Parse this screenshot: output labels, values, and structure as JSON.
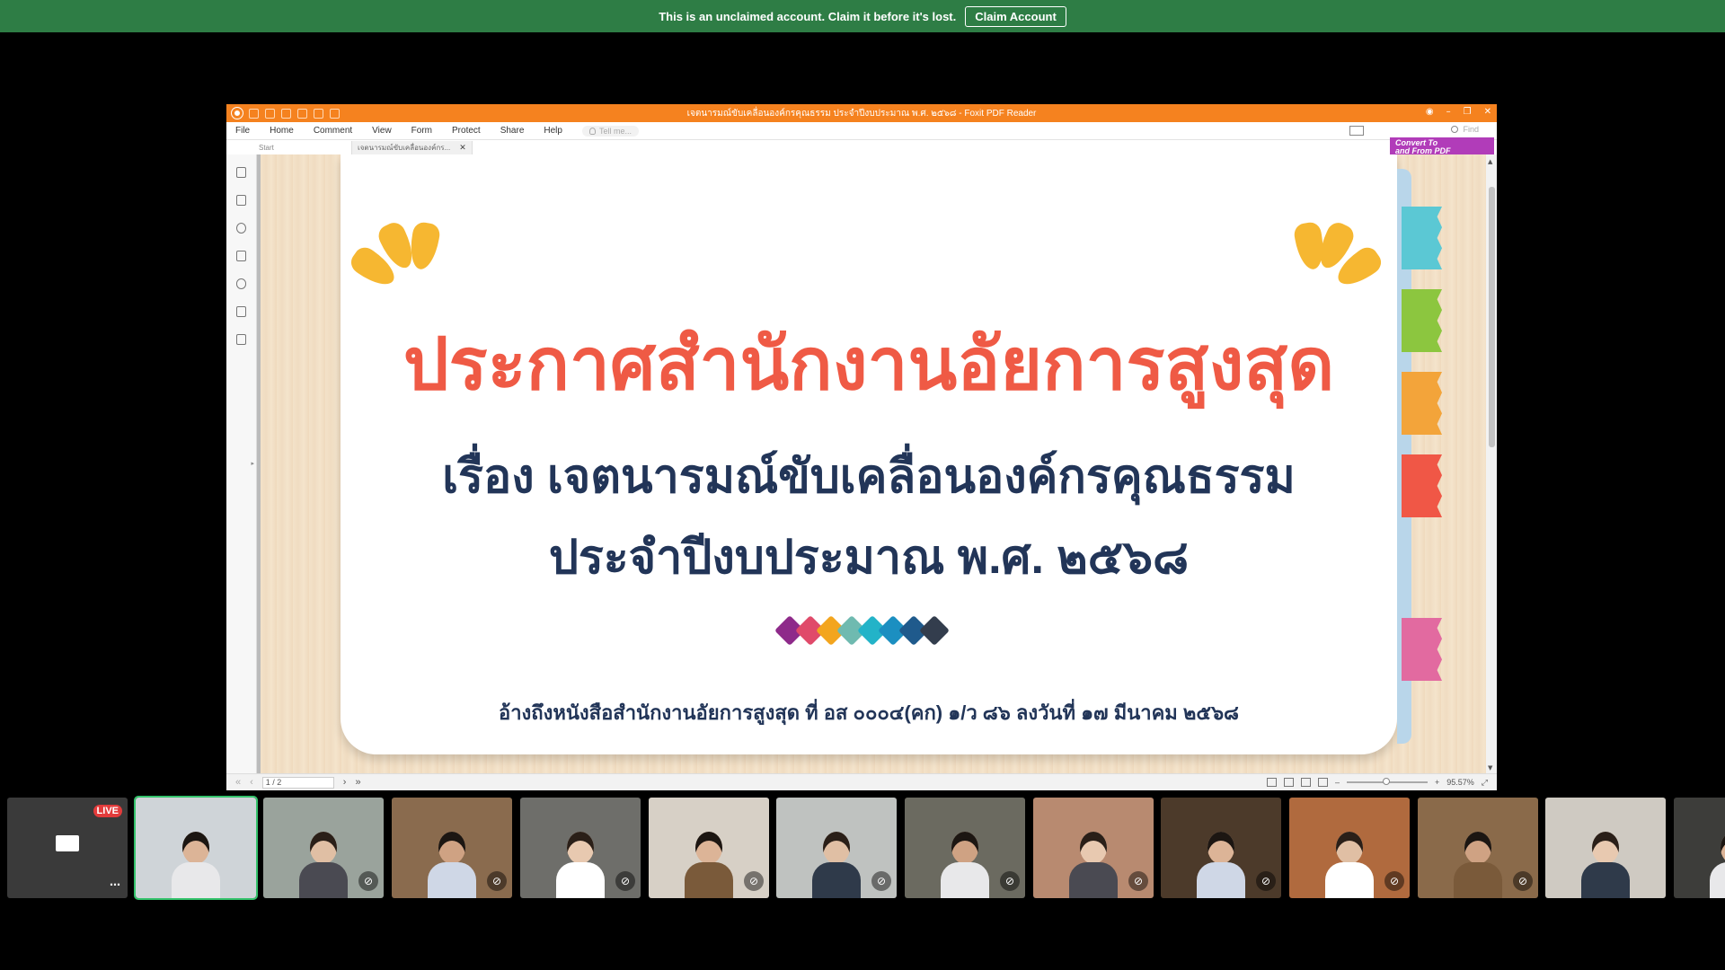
{
  "banner": {
    "message": "This is an unclaimed account. Claim it before it's lost.",
    "button_label": "Claim Account"
  },
  "pdf_reader": {
    "window_title": "เจตนารมณ์ขับเคลื่อนองค์กรคุณธรรม ประจำปีงบประมาณ พ.ศ. ๒๕๖๘ - Foxit PDF Reader",
    "menu": [
      "File",
      "Home",
      "Comment",
      "View",
      "Form",
      "Protect",
      "Share",
      "Help"
    ],
    "tell_me_placeholder": "Tell me...",
    "find_placeholder": "Find",
    "tabs": [
      {
        "label": "Start"
      },
      {
        "label": "เจตนารมณ์ขับเคลื่อนองค์กร..."
      }
    ],
    "convert_button": {
      "line1": "Convert To",
      "line2": "and From PDF"
    },
    "page_indicator": "1 / 2",
    "zoom_level": "95.57%"
  },
  "slide": {
    "title": "ประกาศสำนักงานอัยการสูงสุด",
    "subtitle_line1": "เรื่อง เจตนารมณ์ขับเคลื่อนองค์กรคุณธรรม",
    "subtitle_line2": "ประจำปีงบประมาณ พ.ศ. ๒๕๖๘",
    "reference": "อ้างถึงหนังสือสำนักงานอัยการสูงสุด ที่ อส ๐๐๐๔(คก) ๑/ว ๘๖ ลงวันที่ ๑๗ มีนาคม ๒๕๖๘",
    "diamond_colors": [
      "#8e2a8a",
      "#e04a6a",
      "#f3a51e",
      "#6fbab0",
      "#23b3c8",
      "#1b8fc1",
      "#1f5a8c",
      "#333d4d"
    ],
    "tab_colors": [
      "#5bc8d4",
      "#8cc63f",
      "#f3a43a",
      "#f05746",
      "#e26aa0"
    ]
  },
  "participants": {
    "live_label": "LIVE",
    "tiles": [
      {
        "kind": "screen",
        "live": true
      },
      {
        "kind": "person",
        "active": true,
        "muted": false
      },
      {
        "kind": "person",
        "muted": true
      },
      {
        "kind": "person",
        "muted": true
      },
      {
        "kind": "person",
        "muted": true
      },
      {
        "kind": "person",
        "muted": true
      },
      {
        "kind": "person",
        "muted": true
      },
      {
        "kind": "person",
        "muted": true
      },
      {
        "kind": "person",
        "muted": true
      },
      {
        "kind": "person",
        "muted": true
      },
      {
        "kind": "person",
        "muted": true
      },
      {
        "kind": "person",
        "muted": true
      },
      {
        "kind": "person",
        "muted": false
      },
      {
        "kind": "person",
        "muted": true
      }
    ]
  }
}
